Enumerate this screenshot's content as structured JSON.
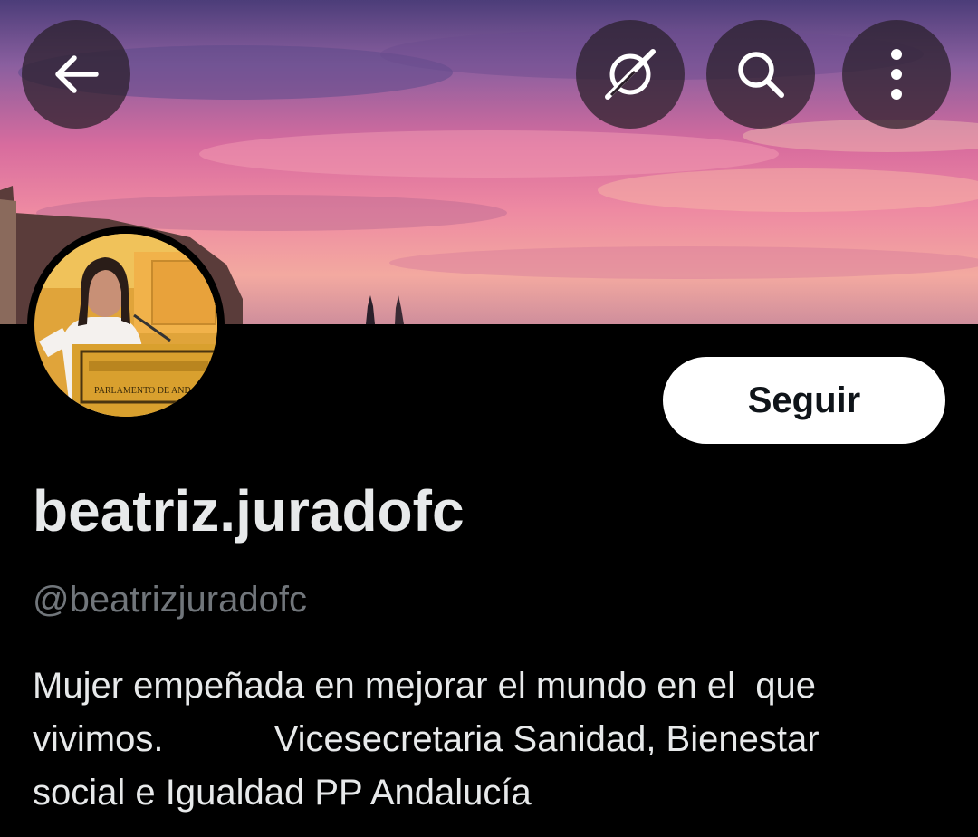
{
  "header": {
    "back_icon": "arrow-left-icon",
    "grok_icon": "grok-icon",
    "search_icon": "search-icon",
    "more_icon": "more-vertical-icon"
  },
  "avatar": {
    "podium_text": "PARLAMENTO DE ANDALUCÍA"
  },
  "profile": {
    "follow_label": "Seguir",
    "display_name": "beatriz.juradofc",
    "handle": "@beatrizjuradofc",
    "bio_lines": [
      "Mujer empeñada en mejorar el mundo en el  que",
      "vivimos.           Vicesecretaria Sanidad, Bienestar",
      "social e Igualdad PP Andalucía"
    ]
  },
  "colors": {
    "background": "#000000",
    "text_primary": "#e7e9ea",
    "text_secondary": "#71767b",
    "follow_bg": "#ffffff",
    "follow_text": "#0f1419"
  }
}
